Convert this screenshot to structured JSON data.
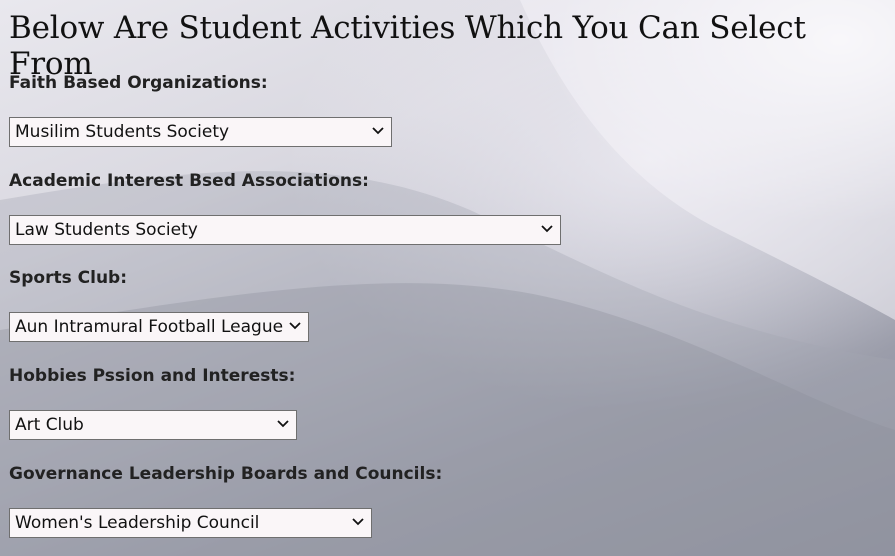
{
  "page": {
    "title": "Below Are Student Activities Which You Can Select From"
  },
  "groups": [
    {
      "label": "Faith Based Organizations:",
      "selected": "Musilim Students Society"
    },
    {
      "label": "Academic Interest Bsed Associations:",
      "selected": "Law Students Society"
    },
    {
      "label": "Sports Club:",
      "selected": "Aun Intramural Football League"
    },
    {
      "label": "Hobbies Pssion and Interests:",
      "selected": "Art Club"
    },
    {
      "label": "Governance Leadership Boards and Councils:",
      "selected": "Women's Leadership Council"
    }
  ],
  "icons": {
    "dropdown": "chevron-down-icon"
  }
}
